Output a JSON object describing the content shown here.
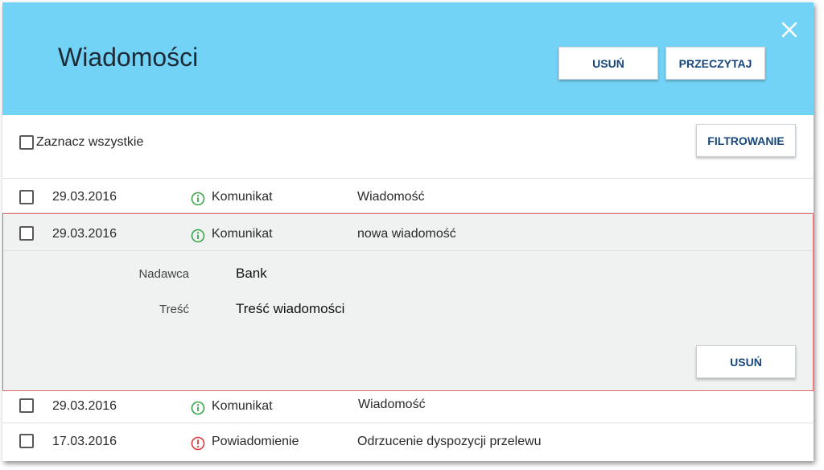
{
  "dialog": {
    "title": "Wiadomości",
    "delete_label": "USUŃ",
    "read_label": "PRZECZYTAJ"
  },
  "toolbar": {
    "select_all_label": "Zaznacz wszystkie",
    "filter_label": "FILTROWANIE"
  },
  "messages": [
    {
      "date": "29.03.2016",
      "type": "Komunikat",
      "type_icon": "info-icon",
      "subject": "Wiadomość"
    },
    {
      "date": "29.03.2016",
      "type": "Komunikat",
      "type_icon": "info-icon",
      "subject": "nowa wiadomość"
    },
    {
      "date": "29.03.2016",
      "type": "Komunikat",
      "type_icon": "info-icon",
      "subject": "Wiadomość"
    },
    {
      "date": "17.03.2016",
      "type": "Powiadomienie",
      "type_icon": "alert-icon",
      "subject": "Odrzucenie dyspozycji przelewu"
    }
  ],
  "details": {
    "sender_label": "Nadawca",
    "sender_value": "Bank",
    "content_label": "Treść",
    "content_value": "Treść wiadomości",
    "delete_label": "USUŃ"
  },
  "colors": {
    "header_bg": "#73d3f6",
    "button_text": "#15457a",
    "info_icon": "#3aa54a",
    "alert_icon": "#d93a3a",
    "expanded_border": "#e26a6a"
  }
}
